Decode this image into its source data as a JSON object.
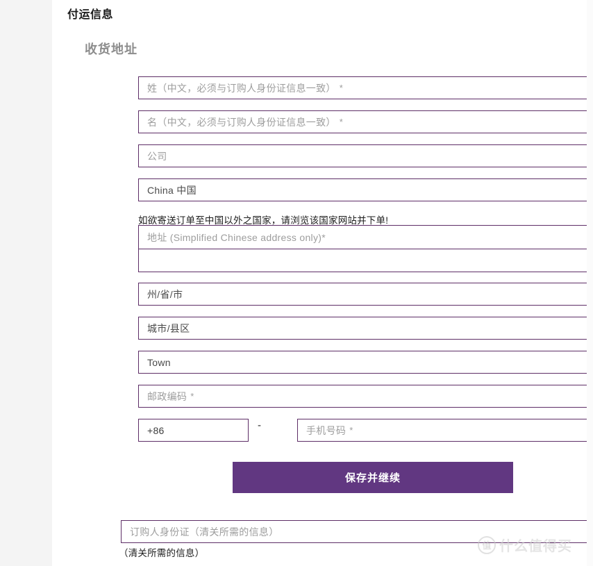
{
  "page": {
    "section_title": "付运信息",
    "sub_title": "收货地址"
  },
  "form": {
    "last_name": {
      "placeholder": "姓（中文，必须与订购人身份证信息一致）",
      "required_mark": "*",
      "value": ""
    },
    "first_name": {
      "placeholder": "名（中文，必须与订购人身份证信息一致）",
      "required_mark": "*",
      "value": ""
    },
    "company": {
      "placeholder": "公司",
      "value": ""
    },
    "country": {
      "selected": "China 中国",
      "chevron": "chevron-down-icon"
    },
    "country_notice": "如欲寄送订单至中国以外之国家，请浏览该国家网站并下单!",
    "address_line1": {
      "placeholder": "地址 (Simplified Chinese address only)",
      "required_mark": "*",
      "value": ""
    },
    "address_line2": {
      "placeholder": "",
      "value": ""
    },
    "province": {
      "selected": "州/省/市",
      "chevron": "chevron-down-icon"
    },
    "city": {
      "selected": "城市/县区",
      "chevron": "chevron-down-icon"
    },
    "town": {
      "selected": "Town",
      "chevron": "chevron-down-icon"
    },
    "postal_code": {
      "placeholder": "邮政编码",
      "required_mark": "*",
      "value": ""
    },
    "phone_country_code": {
      "value": "+86"
    },
    "phone_separator": "-",
    "phone_number": {
      "placeholder": "手机号码",
      "required_mark": "*",
      "value": ""
    },
    "submit_label": "保存并继续",
    "id_number": {
      "placeholder": "订购人身份证（清关所需的信息）",
      "value": ""
    },
    "id_number_note": "（清关所需的信息）"
  },
  "watermark": {
    "badge": "值",
    "text": "什么值得买"
  },
  "colors": {
    "field_border": "#5d2d66",
    "button_bg": "#613781",
    "placeholder": "#9d9d9d",
    "page_bg": "#f4f4f4"
  }
}
